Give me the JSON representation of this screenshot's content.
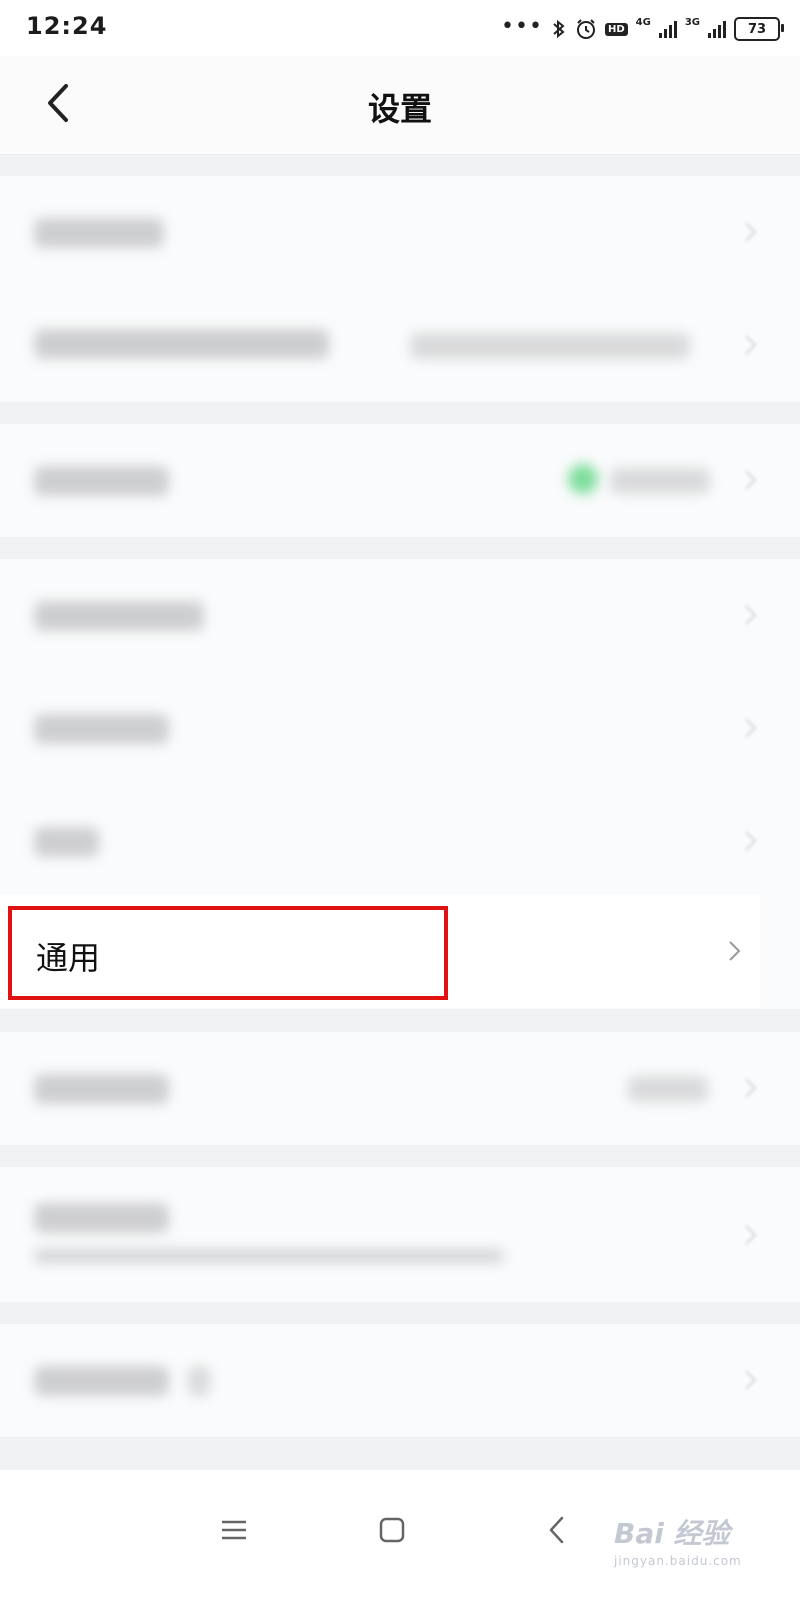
{
  "status_bar": {
    "time": "12:24",
    "network_4g": "4G",
    "network_3g": "3G",
    "battery": "73"
  },
  "header": {
    "title": "设置"
  },
  "settings": {
    "general_label": "通用"
  },
  "watermark": {
    "brand": "Bai 经验",
    "url": "jingyan.baidu.com"
  },
  "colors": {
    "highlight_box": "#e01111",
    "toggle_green": "#7edd9c"
  },
  "icons": {
    "back": "chevron-left-icon",
    "row_arrow": "chevron-right-icon",
    "menu": "menu-icon",
    "home": "home-icon",
    "nav_back": "nav-back-icon"
  }
}
